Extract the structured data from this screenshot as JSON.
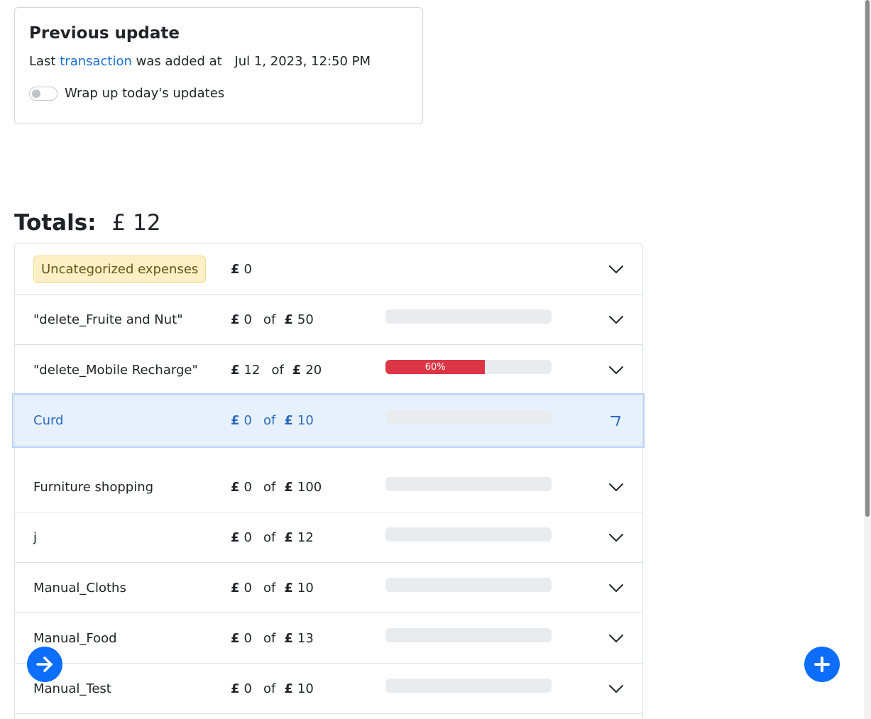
{
  "previous_update": {
    "title": "Previous update",
    "text_before": "Last",
    "link": "transaction",
    "text_after": "was added at",
    "datetime": "Jul 1, 2023, 12:50 PM",
    "toggle_label": "Wrap up today's updates"
  },
  "totals": {
    "label": "Totals:",
    "currency": "£",
    "amount": "12"
  },
  "budgets": [
    {
      "name": "Uncategorized expenses",
      "spent": "0",
      "limit": null,
      "progress_percent": null,
      "badge": true
    },
    {
      "name": "\"delete_Fruite and Nut\"",
      "spent": "0",
      "limit": "50",
      "progress_percent": 0
    },
    {
      "name": "\"delete_Mobile Recharge\"",
      "spent": "12",
      "limit": "20",
      "progress_percent": 60,
      "progress_label": "60%"
    },
    {
      "name": "Curd",
      "spent": "0",
      "limit": "10",
      "progress_percent": 0,
      "active": true
    },
    {
      "name": "Furniture shopping",
      "spent": "0",
      "limit": "100",
      "progress_percent": 0
    },
    {
      "name": "j",
      "spent": "0",
      "limit": "12",
      "progress_percent": 0
    },
    {
      "name": "Manual_Cloths",
      "spent": "0",
      "limit": "10",
      "progress_percent": 0
    },
    {
      "name": "Manual_Food",
      "spent": "0",
      "limit": "13",
      "progress_percent": 0
    },
    {
      "name": "Manual_Test",
      "spent": "0",
      "limit": "10",
      "progress_percent": 0
    }
  ],
  "labels": {
    "currency_symbol": "£",
    "of": "of"
  },
  "icons": {
    "row_toggle": "chevron-down-icon",
    "left_fab": "arrow-right-icon",
    "right_fab": "plus-icon"
  },
  "colors": {
    "accent": "#0d6efd",
    "link": "#1a6fd6",
    "progress_over": "#dc3545",
    "badge_bg": "#fdf0c7"
  }
}
